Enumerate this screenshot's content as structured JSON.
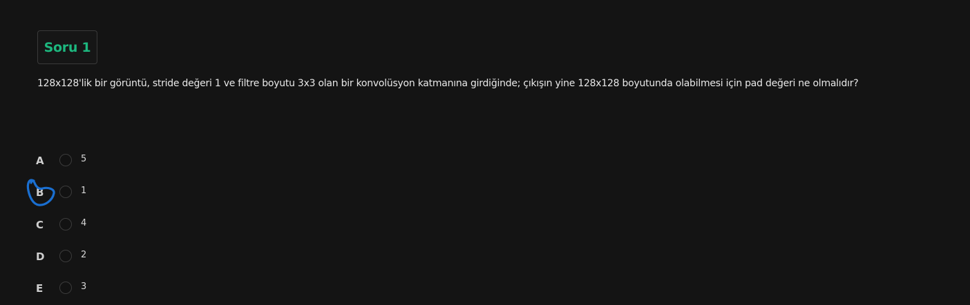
{
  "question": {
    "badge_label": "Soru 1",
    "text": "128x128'lik bir görüntü, stride değeri 1 ve filtre boyutu 3x3 olan bir konvolüsyon katmanına girdiğinde; çıkışın yine 128x128 boyutunda olabilmesi için pad değeri ne olmalıdır?"
  },
  "options": [
    {
      "letter": "A",
      "value": "5"
    },
    {
      "letter": "B",
      "value": "1"
    },
    {
      "letter": "C",
      "value": "4"
    },
    {
      "letter": "D",
      "value": "2"
    },
    {
      "letter": "E",
      "value": "3"
    }
  ],
  "colors": {
    "background": "#141414",
    "accent": "#1db87f",
    "annotation": "#1a6fd1"
  }
}
